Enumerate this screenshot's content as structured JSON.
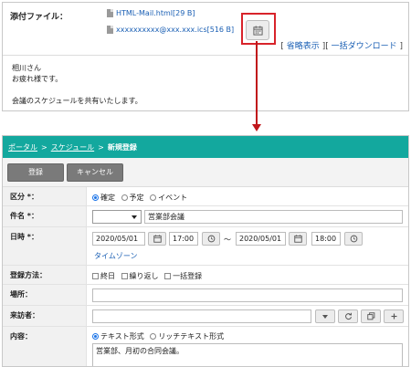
{
  "mail": {
    "attach_label": "添付ファイル：",
    "files": [
      {
        "name": "HTML-Mail.html[29 B]"
      },
      {
        "name": "xxxxxxxxxx@xxx.xxx.ics[516 B]"
      }
    ],
    "link_abbrev": "省略表示",
    "link_download": "一括ダウンロード",
    "bracket_open": "[",
    "bracket_mid": "][",
    "bracket_close": "]",
    "body_lines": [
      "相川さん",
      "お疲れ様です。",
      "",
      "会議のスケジュールを共有いたします。"
    ]
  },
  "form": {
    "breadcrumb": {
      "portal": "ポータル",
      "schedule": "スケジュール",
      "current": "新規登録",
      "sep": ">"
    },
    "buttons": {
      "save": "登録",
      "cancel": "キャンセル"
    },
    "type": {
      "label": "区分 *：",
      "options": [
        "確定",
        "予定",
        "イベント"
      ],
      "selected": "確定"
    },
    "subject": {
      "label": "件名 *：",
      "value": "営業部会議"
    },
    "datetime": {
      "label": "日時 *：",
      "start_date": "2020/05/01",
      "start_time": "17:00",
      "tilde": "～",
      "end_date": "2020/05/01",
      "end_time": "18:00",
      "timezone": "タイムゾーン"
    },
    "method": {
      "label": "登録方法：",
      "options": [
        "終日",
        "繰り返し",
        "一括登録"
      ]
    },
    "place": {
      "label": "場所：",
      "value": ""
    },
    "visitor": {
      "label": "来訪者：",
      "value": ""
    },
    "content": {
      "label": "内容：",
      "formats": [
        "テキスト形式",
        "リッチテキスト形式"
      ],
      "selected": "テキスト形式",
      "value": "営業部、月初の合同会議。"
    }
  },
  "colors": {
    "accent": "#13a89e",
    "highlight": "#d8232a",
    "link": "#1a5fb4"
  }
}
